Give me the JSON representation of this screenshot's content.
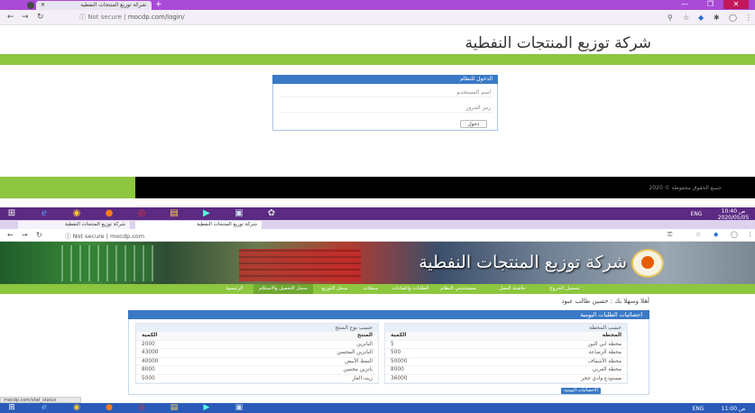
{
  "browser1": {
    "tab_title": "شركة توزيع المنتجات النفطية",
    "tab_close": "✕",
    "new_tab": "+",
    "url_secure": "ⓘ Not secure",
    "url_separator": "|",
    "url_text": "mocdp.com/login/",
    "window_controls": {
      "minimize": "—",
      "maximize": "❐",
      "close": "✕"
    }
  },
  "login_page": {
    "site_title": "شركة توزيع المنتجات النفطية",
    "box_title": "الدخول للنظام",
    "username_placeholder": "اسم المستخدم",
    "password_placeholder": "رمز المرور",
    "login_button": "دخول",
    "footer": "2020 © جميع الحقوق محفوظة"
  },
  "taskbar1": {
    "clock_time": "10:40 ص",
    "clock_date": "2020/05/05",
    "lang": "ENG"
  },
  "browser2": {
    "tab1_title": "شركة توزيع المنتجات النفطية",
    "tab2_title": "شركة توزيع المنتجات النفطية",
    "url_secure": "ⓘ Not secure",
    "url_separator": "|",
    "url_text": "mocdp.com"
  },
  "header": {
    "banner_title": "شركة توزيع المنتجات النفطية"
  },
  "nav": {
    "items": [
      {
        "label": "الرئيسية"
      },
      {
        "label": "سجل التحميل والاستلام"
      },
      {
        "label": "سجل التوزيع"
      },
      {
        "label": "سجلات"
      },
      {
        "label": "الطلبات والقيادات"
      },
      {
        "label": "مستخدمي النظام"
      },
      {
        "label": "حاضنة العمل"
      },
      {
        "label": "تسجيل الخروج"
      }
    ]
  },
  "greeting": "أهلا وسهلا بك : حسين طالب عبود",
  "stats": {
    "panel_title": "احصائيات الطلبات اليومية",
    "by_governorate": {
      "title": "حسب المحطة",
      "col_name": "المحطة",
      "col_qty": "الكمية",
      "rows": [
        {
          "name": "محطة ابي النور",
          "qty": "5"
        },
        {
          "name": "محطة الرضاعة",
          "qty": "500"
        },
        {
          "name": "محطة الأشقاف",
          "qty": "50000"
        },
        {
          "name": "محطة العربي",
          "qty": "8000"
        },
        {
          "name": "مستودع وادي حجر",
          "qty": "36000"
        }
      ]
    },
    "by_product": {
      "title": "حسب نوع المنتج",
      "col_name": "المنتج",
      "col_qty": "الكمية",
      "rows": [
        {
          "name": "البانزين",
          "qty": "2000"
        },
        {
          "name": "البانزين المحسن",
          "qty": "43000"
        },
        {
          "name": "النفط الأبيض",
          "qty": "40000"
        },
        {
          "name": "بانزين محسن",
          "qty": "8000"
        },
        {
          "name": "زيت الغاز",
          "qty": "5000"
        }
      ]
    },
    "today_button": "الاحصائيات اليومية"
  },
  "statusbar": "mocdp.com/stat_status",
  "taskbar2": {
    "clock_time": "11:00 ص",
    "lang": "ENG"
  },
  "colors": {
    "accent_green": "#8dc63f",
    "panel_blue": "#3a79c6",
    "browser_purple": "#a84ad6"
  }
}
